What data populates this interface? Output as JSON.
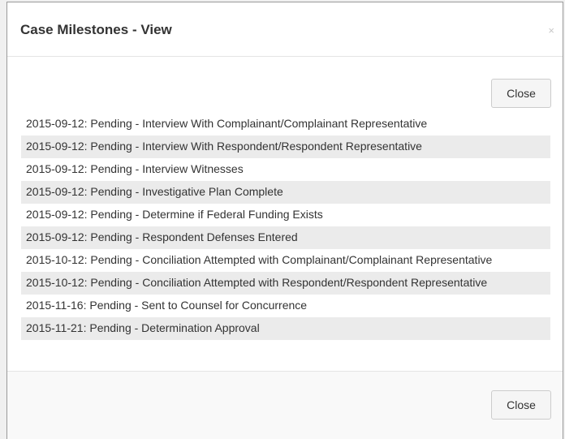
{
  "dialog": {
    "title": "Case Milestones - View",
    "close_icon": "×",
    "close_top_label": "Close",
    "close_bottom_label": "Close"
  },
  "milestones": [
    "2015-09-12: Pending - Interview With Complainant/Complainant Representative",
    "2015-09-12: Pending - Interview With Respondent/Respondent Representative",
    "2015-09-12: Pending - Interview Witnesses",
    "2015-09-12: Pending - Investigative Plan Complete",
    "2015-09-12: Pending - Determine if Federal Funding Exists",
    "2015-09-12: Pending - Respondent Defenses Entered",
    "2015-10-12: Pending - Conciliation Attempted with Complainant/Complainant Representative",
    "2015-10-12: Pending - Conciliation Attempted with Respondent/Respondent Representative",
    "2015-11-16: Pending - Sent to Counsel for Concurrence",
    "2015-11-21: Pending - Determination Approval"
  ]
}
